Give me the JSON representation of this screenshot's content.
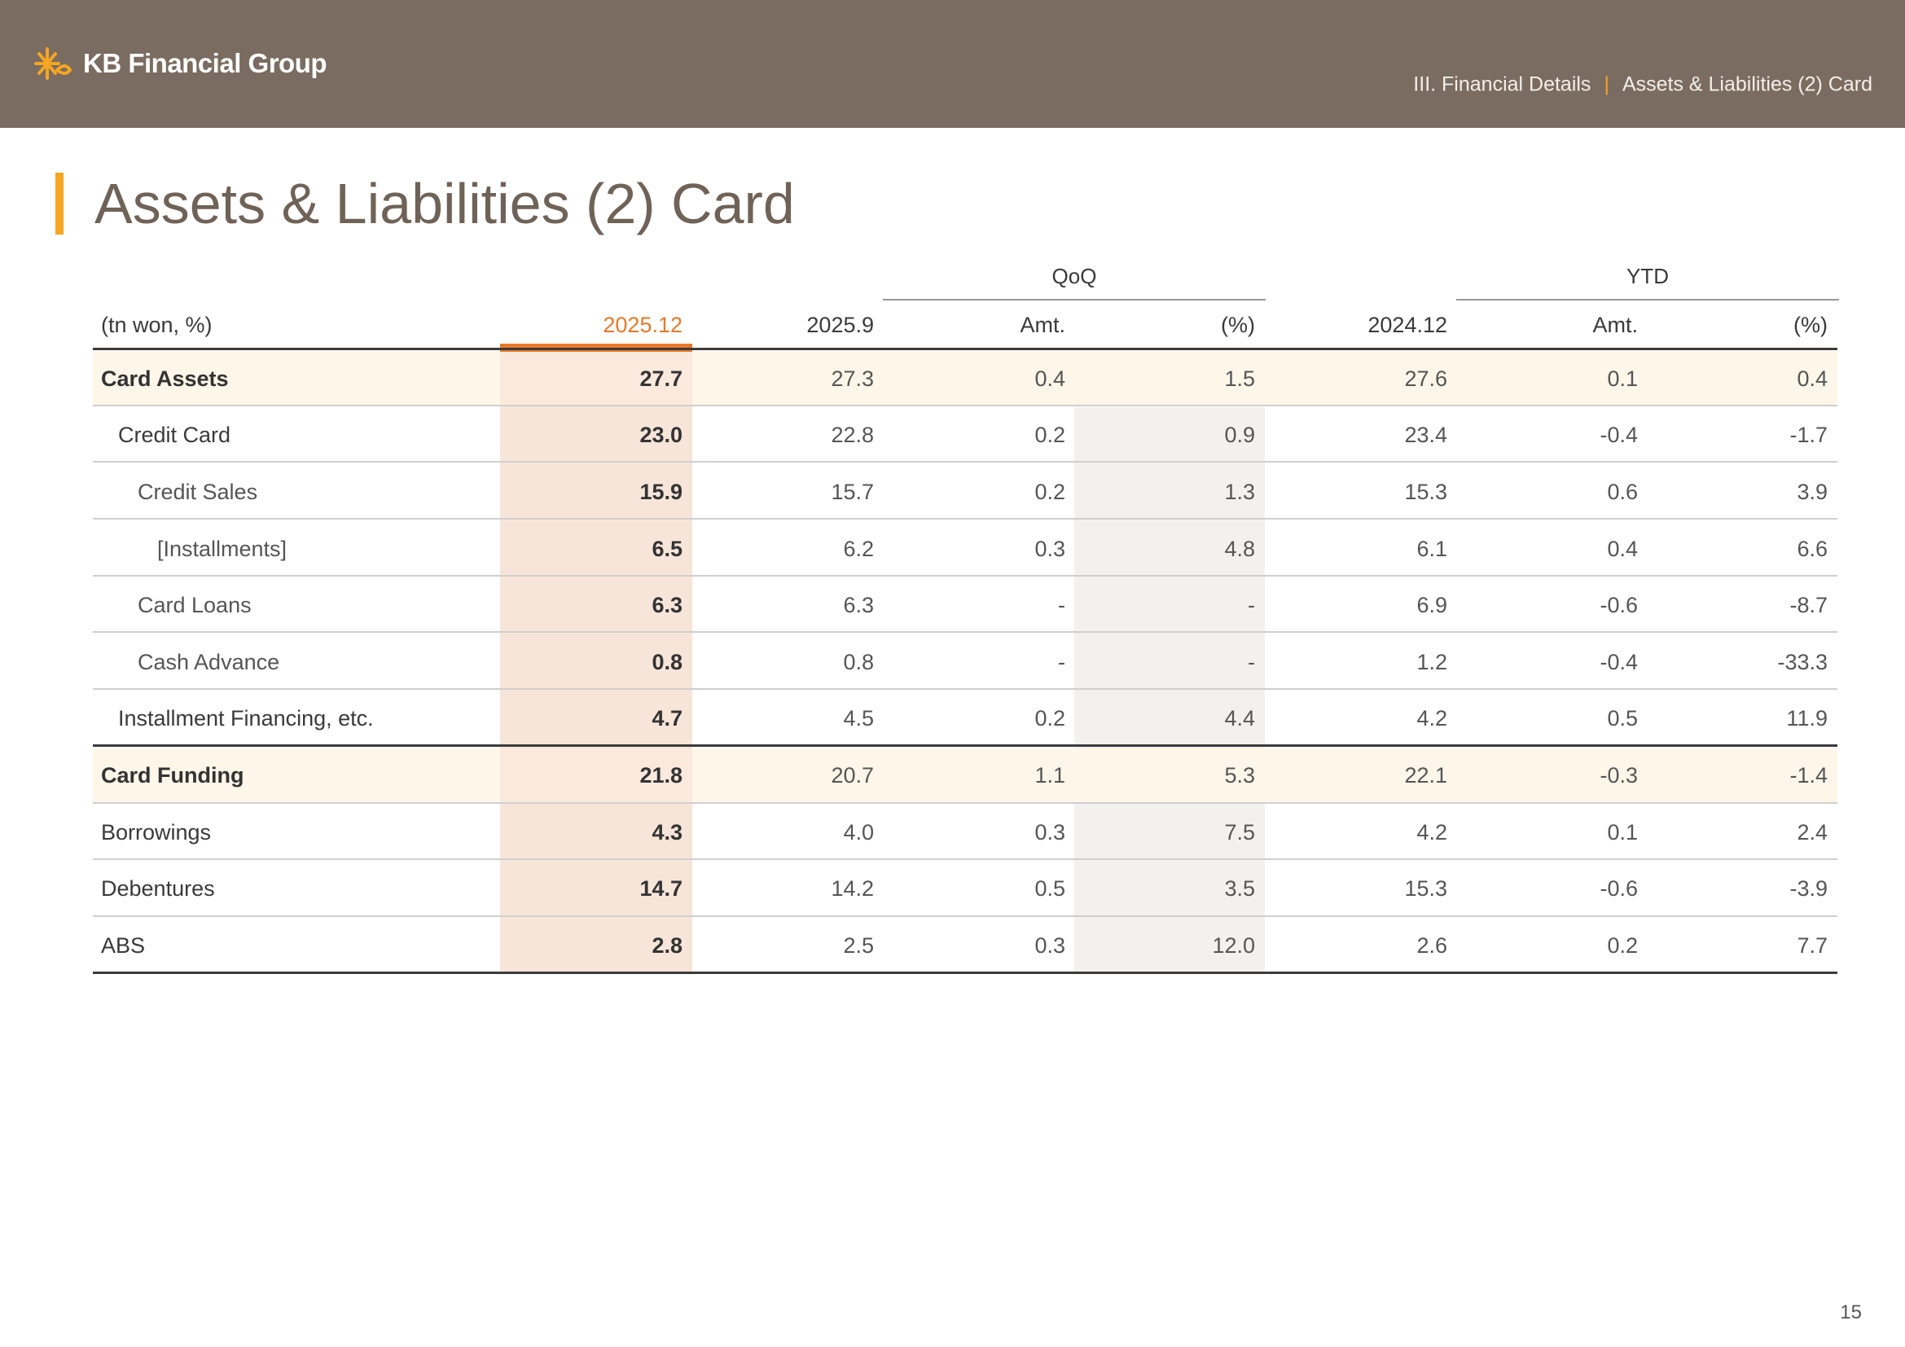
{
  "header": {
    "brand": "KB Financial Group",
    "section": "III. Financial Details",
    "separator": "|",
    "page": "Assets & Liabilities (2) Card"
  },
  "title": "Assets & Liabilities (2) Card",
  "table": {
    "unit": "(tn won, %)",
    "groups": {
      "qoq": "QoQ",
      "ytd": "YTD"
    },
    "columns": [
      "2025.12",
      "2025.9",
      "Amt.",
      "(%)",
      "2024.12",
      "Amt.",
      "(%)"
    ],
    "rows": [
      {
        "label": "Card Assets",
        "values": [
          "27.7",
          "27.3",
          "0.4",
          "1.5",
          "27.6",
          "0.1",
          "0.4"
        ]
      },
      {
        "label": "Credit Card",
        "values": [
          "23.0",
          "22.8",
          "0.2",
          "0.9",
          "23.4",
          "-0.4",
          "-1.7"
        ]
      },
      {
        "label": "Credit Sales",
        "values": [
          "15.9",
          "15.7",
          "0.2",
          "1.3",
          "15.3",
          "0.6",
          "3.9"
        ]
      },
      {
        "label": "[Installments]",
        "values": [
          "6.5",
          "6.2",
          "0.3",
          "4.8",
          "6.1",
          "0.4",
          "6.6"
        ]
      },
      {
        "label": "Card Loans",
        "values": [
          "6.3",
          "6.3",
          "-",
          "-",
          "6.9",
          "-0.6",
          "-8.7"
        ]
      },
      {
        "label": "Cash Advance",
        "values": [
          "0.8",
          "0.8",
          "-",
          "-",
          "1.2",
          "-0.4",
          "-33.3"
        ]
      },
      {
        "label": "Installment Financing, etc.",
        "values": [
          "4.7",
          "4.5",
          "0.2",
          "4.4",
          "4.2",
          "0.5",
          "11.9"
        ]
      },
      {
        "label": "Card Funding",
        "values": [
          "21.8",
          "20.7",
          "1.1",
          "5.3",
          "22.1",
          "-0.3",
          "-1.4"
        ]
      },
      {
        "label": "Borrowings",
        "values": [
          "4.3",
          "4.0",
          "0.3",
          "7.5",
          "4.2",
          "0.1",
          "2.4"
        ]
      },
      {
        "label": "Debentures",
        "values": [
          "14.7",
          "14.2",
          "0.5",
          "3.5",
          "15.3",
          "-0.6",
          "-3.9"
        ]
      },
      {
        "label": "ABS",
        "values": [
          "2.8",
          "2.5",
          "0.3",
          "12.0",
          "2.6",
          "0.2",
          "7.7"
        ]
      }
    ]
  },
  "page_number": "15",
  "colors": {
    "topbar": "#7a6c60",
    "accent": "#f5a623",
    "current": "#e8792a"
  }
}
